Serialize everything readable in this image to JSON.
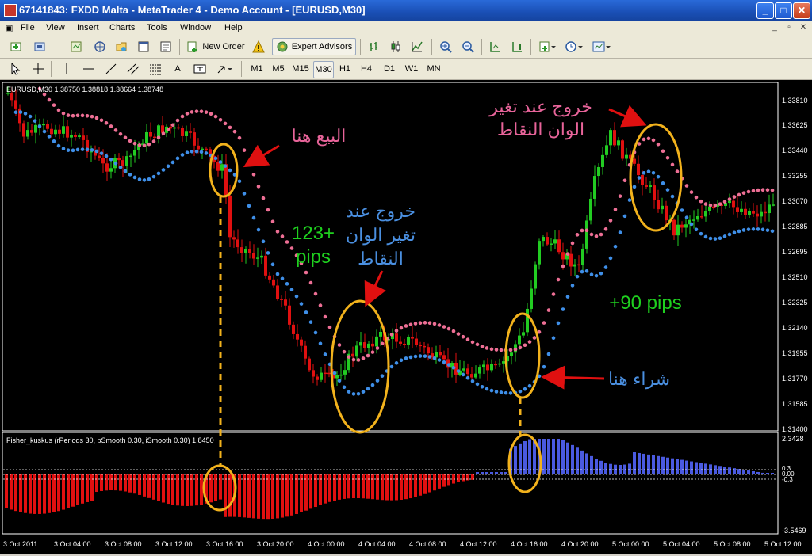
{
  "window": {
    "title": "67141843: FXDD Malta - MetaTrader 4 - Demo Account - [EURUSD,M30]",
    "minimize_label": "_",
    "maximize_label": "□",
    "close_label": "✕"
  },
  "menu": {
    "items": [
      "File",
      "View",
      "Insert",
      "Charts",
      "Tools",
      "Window",
      "Help"
    ],
    "doc_controls": [
      "_",
      "▫",
      "✕"
    ]
  },
  "toolbar": {
    "new_order_label": "New Order",
    "expert_advisors_label": "Expert Advisors",
    "timeframes": [
      "M1",
      "M5",
      "M15",
      "M30",
      "H1",
      "H4",
      "D1",
      "W1",
      "MN"
    ],
    "active_timeframe": "M30",
    "text_tool_label": "A"
  },
  "chart": {
    "info_text": "EURUSD,M30  1.38750 1.38818 1.38664 1.38748",
    "price_labels": [
      "1.33810",
      "1.33625",
      "1.33440",
      "1.33255",
      "1.33070",
      "1.32885",
      "1.32695",
      "1.32510",
      "1.32325",
      "1.32140",
      "1.31955",
      "1.31770",
      "1.31585",
      "1.31400"
    ],
    "time_labels": [
      "3 Oct 2011",
      "3 Oct 04:00",
      "3 Oct 08:00",
      "3 Oct 12:00",
      "3 Oct 16:00",
      "3 Oct 20:00",
      "4 Oct 00:00",
      "4 Oct 04:00",
      "4 Oct 08:00",
      "4 Oct 12:00",
      "4 Oct 16:00",
      "4 Oct 20:00",
      "5 Oct 00:00",
      "5 Oct 04:00",
      "5 Oct 08:00",
      "5 Oct 12:00"
    ],
    "annotations": {
      "sell_here": "البيع هنا",
      "buy_here": "شراء هنا",
      "exit_top_line1": "خروج عند تغير",
      "exit_top_line2": "الوان النقاط",
      "exit_mid_line1": "خروج عند",
      "exit_mid_line2": "تغير الوان",
      "exit_mid_line3": "النقاط",
      "pips_sell_line1": "123+",
      "pips_sell_line2": "pips",
      "pips_buy": "+90 pips"
    },
    "colors": {
      "bull": "#22cc22",
      "bear": "#e01010",
      "dots_blue": "#3f8fe8",
      "dots_pink": "#ee6f95",
      "ellipse": "#f2b21c",
      "annot_pink": "#e8649a",
      "annot_blue": "#4a8fe0",
      "annot_green": "#1fd01f"
    }
  },
  "indicator": {
    "info_text": "Fisher_kuskus  (rPeriods 30, pSmooth 0.30, iSmooth 0.30)   1.8450",
    "scale_labels": [
      "2.3428",
      "0.3",
      "0.00",
      "-0.3",
      "-3.5469"
    ],
    "colors": {
      "up": "#4a5ae0",
      "down": "#e01010"
    }
  }
}
